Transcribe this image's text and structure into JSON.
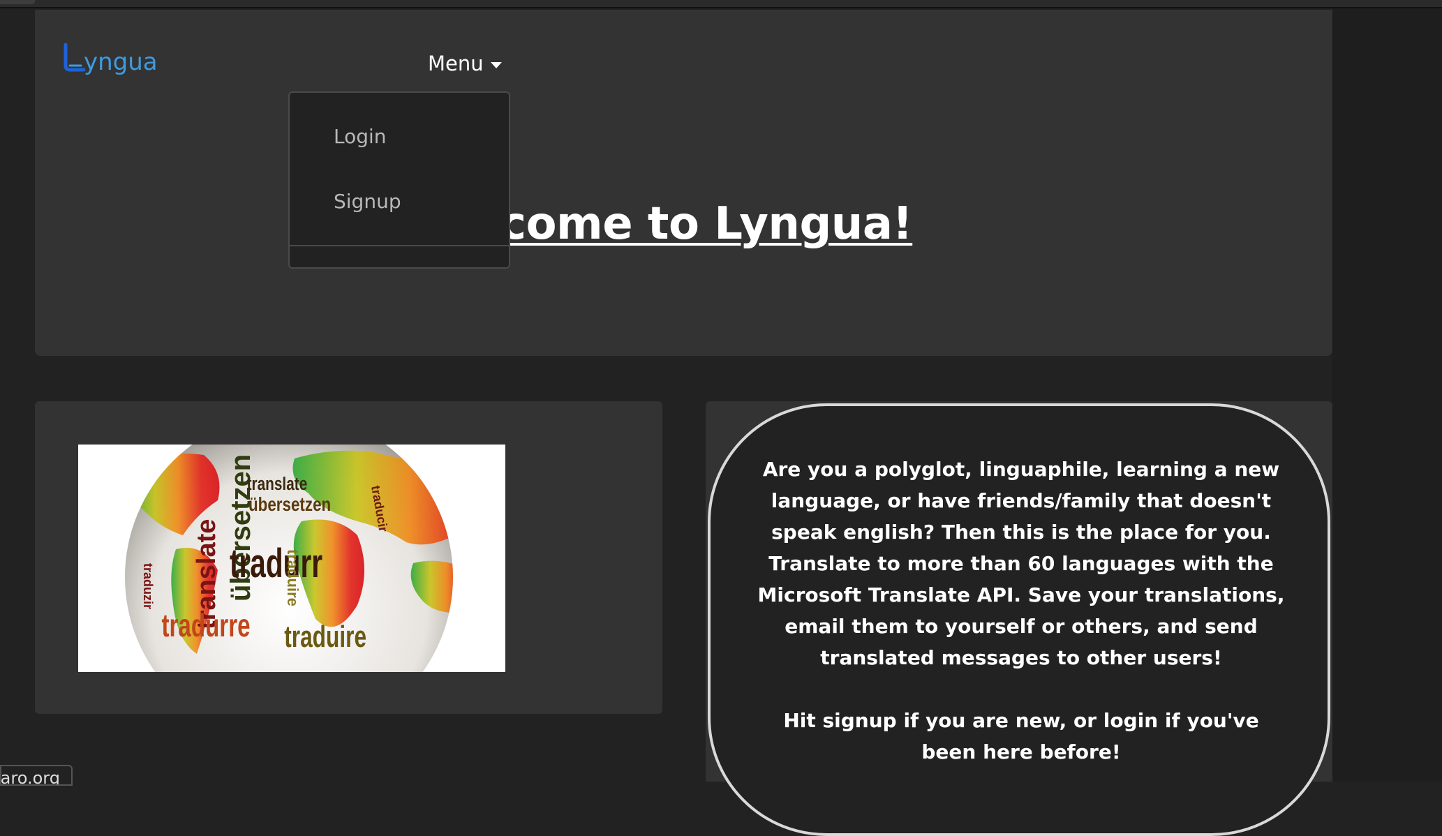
{
  "brand": {
    "name": "yngua",
    "accent": "#3f9be0"
  },
  "nav": {
    "menu_label": "Menu"
  },
  "dropdown": {
    "items": [
      {
        "label": "Login"
      },
      {
        "label": "Signup"
      }
    ]
  },
  "hero": {
    "title": "elcome to Lyngua!"
  },
  "pitch": {
    "paragraph1": "Are you a polyglot, linguaphile, learning a new language, or have friends/family that doesn't speak english? Then this is the place for you. Translate to more than 60 languages with the Microsoft Translate API. Save your translations, email them to yourself or others, and send translated messages to other users!",
    "paragraph2": "Hit signup if you are new, or login if you've been here before!"
  },
  "image": {
    "words": [
      "translate",
      "übersetzen",
      "tradurre",
      "traduire",
      "traduzir",
      "translate",
      "übersetzen",
      "traduire",
      "traducir"
    ]
  },
  "status": {
    "url_fragment": "iaro.org"
  },
  "colors": {
    "page_bg": "#222222",
    "panel_bg": "#333333",
    "text": "#ffffff",
    "muted_text": "#b8b8b8"
  }
}
